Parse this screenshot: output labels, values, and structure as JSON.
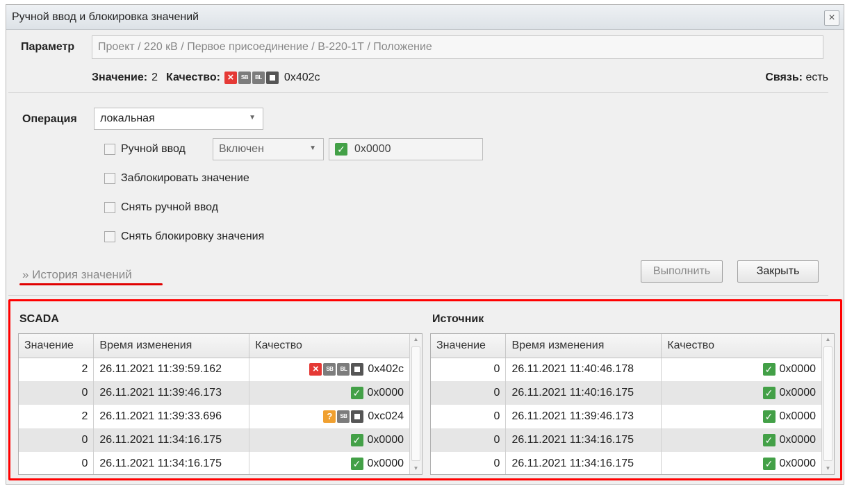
{
  "window": {
    "title": "Ручной ввод и блокировка значений",
    "close_glyph": "×"
  },
  "parameter": {
    "label": "Параметр",
    "path": "Проект / 220 кВ / Первое присоединение / В-220-1Т / Положение"
  },
  "status": {
    "value_label": "Значение:",
    "value": "2",
    "quality_label": "Качество:",
    "quality_code": "0x402c",
    "quality_badges": [
      "x-red-icon",
      "sb-badge-icon",
      "bl-badge-icon",
      "square-badge-icon"
    ],
    "link_label": "Связь:",
    "link_value": "есть"
  },
  "operation": {
    "label": "Операция",
    "selected": "локальная",
    "manual_input_label": "Ручной ввод",
    "manual_mode": "Включен",
    "manual_quality_code": "0x0000",
    "block_value_label": "Заблокировать значение",
    "remove_manual_label": "Снять ручной ввод",
    "remove_block_label": "Снять блокировку значения"
  },
  "history_link": "» История значений",
  "buttons": {
    "execute": "Выполнить",
    "close": "Закрыть"
  },
  "scada": {
    "title": "SCADA",
    "columns": [
      "Значение",
      "Время изменения",
      "Качество"
    ],
    "rows": [
      {
        "value": "2",
        "time": "26.11.2021 11:39:59.162",
        "quality": "0x402c",
        "badges": [
          "x-red-icon",
          "sb-badge-icon",
          "bl-badge-icon",
          "square-badge-icon"
        ]
      },
      {
        "value": "0",
        "time": "26.11.2021 11:39:46.173",
        "quality": "0x0000",
        "badges": [
          "check-green-icon"
        ]
      },
      {
        "value": "2",
        "time": "26.11.2021 11:39:33.696",
        "quality": "0xc024",
        "badges": [
          "question-orange-icon",
          "sb-badge-icon",
          "square-badge-icon"
        ]
      },
      {
        "value": "0",
        "time": "26.11.2021 11:34:16.175",
        "quality": "0x0000",
        "badges": [
          "check-green-icon"
        ]
      },
      {
        "value": "0",
        "time": "26.11.2021 11:34:16.175",
        "quality": "0x0000",
        "badges": [
          "check-green-icon"
        ]
      }
    ]
  },
  "source": {
    "title": "Источник",
    "columns": [
      "Значение",
      "Время изменения",
      "Качество"
    ],
    "rows": [
      {
        "value": "0",
        "time": "26.11.2021 11:40:46.178",
        "quality": "0x0000",
        "badges": [
          "check-green-icon"
        ]
      },
      {
        "value": "0",
        "time": "26.11.2021 11:40:16.175",
        "quality": "0x0000",
        "badges": [
          "check-green-icon"
        ]
      },
      {
        "value": "0",
        "time": "26.11.2021 11:39:46.173",
        "quality": "0x0000",
        "badges": [
          "check-green-icon"
        ]
      },
      {
        "value": "0",
        "time": "26.11.2021 11:34:16.175",
        "quality": "0x0000",
        "badges": [
          "check-green-icon"
        ]
      },
      {
        "value": "0",
        "time": "26.11.2021 11:34:16.175",
        "quality": "0x0000",
        "badges": [
          "check-green-icon"
        ]
      }
    ]
  },
  "colors": {
    "highlight_red": "#ff0000",
    "quality_bad": "#e53935",
    "quality_good": "#43a047",
    "quality_questionable": "#f0a030"
  }
}
